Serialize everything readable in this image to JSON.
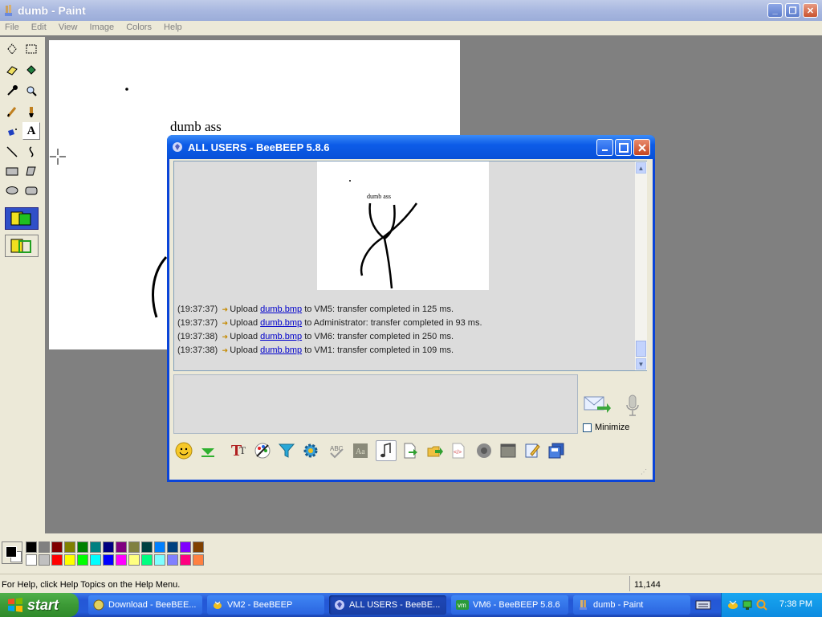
{
  "paint": {
    "title": "dumb - Paint",
    "menu": [
      "File",
      "Edit",
      "View",
      "Image",
      "Colors",
      "Help"
    ],
    "canvas_text": "dumb ass",
    "status_help": "For Help, click Help Topics on the Help Menu.",
    "status_coords": "11,144",
    "palette_colors": [
      "#000000",
      "#808080",
      "#800000",
      "#808000",
      "#008000",
      "#008080",
      "#000080",
      "#800080",
      "#808040",
      "#004040",
      "#0080ff",
      "#004080",
      "#8000ff",
      "#804000",
      "#ffffff",
      "#c0c0c0",
      "#ff0000",
      "#ffff00",
      "#00ff00",
      "#00ffff",
      "#0000ff",
      "#ff00ff",
      "#ffff80",
      "#00ff80",
      "#80ffff",
      "#8080ff",
      "#ff0080",
      "#ff8040"
    ],
    "primary_color": "#000000",
    "secondary_color": "#ffffff"
  },
  "beebeep": {
    "title": "ALL USERS - BeeBEEP 5.8.6",
    "image_caption": "dumb ass",
    "messages": [
      {
        "time": "(19:37:37)",
        "prefix": "Upload",
        "file": "dumb.bmp",
        "suffix": "to VM5: transfer completed in 125 ms."
      },
      {
        "time": "(19:37:37)",
        "prefix": "Upload",
        "file": "dumb.bmp",
        "suffix": "to Administrator: transfer completed in 93 ms."
      },
      {
        "time": "(19:37:38)",
        "prefix": "Upload",
        "file": "dumb.bmp",
        "suffix": "to VM6: transfer completed in 250 ms."
      },
      {
        "time": "(19:37:38)",
        "prefix": "Upload",
        "file": "dumb.bmp",
        "suffix": "to VM1: transfer completed in 109 ms."
      }
    ],
    "minimize_label": "Minimize",
    "toolbar_icons": [
      "emoticon-icon",
      "save-down-icon",
      "font-icon",
      "color-palette-icon",
      "filter-icon",
      "settings-gear-icon",
      "spellcheck-icon",
      "compact-icon",
      "music-note-icon",
      "send-file-icon",
      "send-folder-icon",
      "html-icon",
      "record-icon",
      "screenshot-icon",
      "edit-notes-icon",
      "save-chat-icon"
    ]
  },
  "taskbar": {
    "start_label": "start",
    "tasks": [
      {
        "label": "Download - BeeBEE...",
        "icon": "browser-icon"
      },
      {
        "label": "VM2 - BeeBEEP",
        "icon": "bee-icon"
      },
      {
        "label": "ALL USERS - BeeBE...",
        "icon": "beebeep-icon"
      },
      {
        "label": "VM6 - BeeBEEP 5.8.6",
        "icon": "vm-icon"
      },
      {
        "label": "dumb - Paint",
        "icon": "paint-icon"
      }
    ],
    "clock": "7:38 PM"
  }
}
